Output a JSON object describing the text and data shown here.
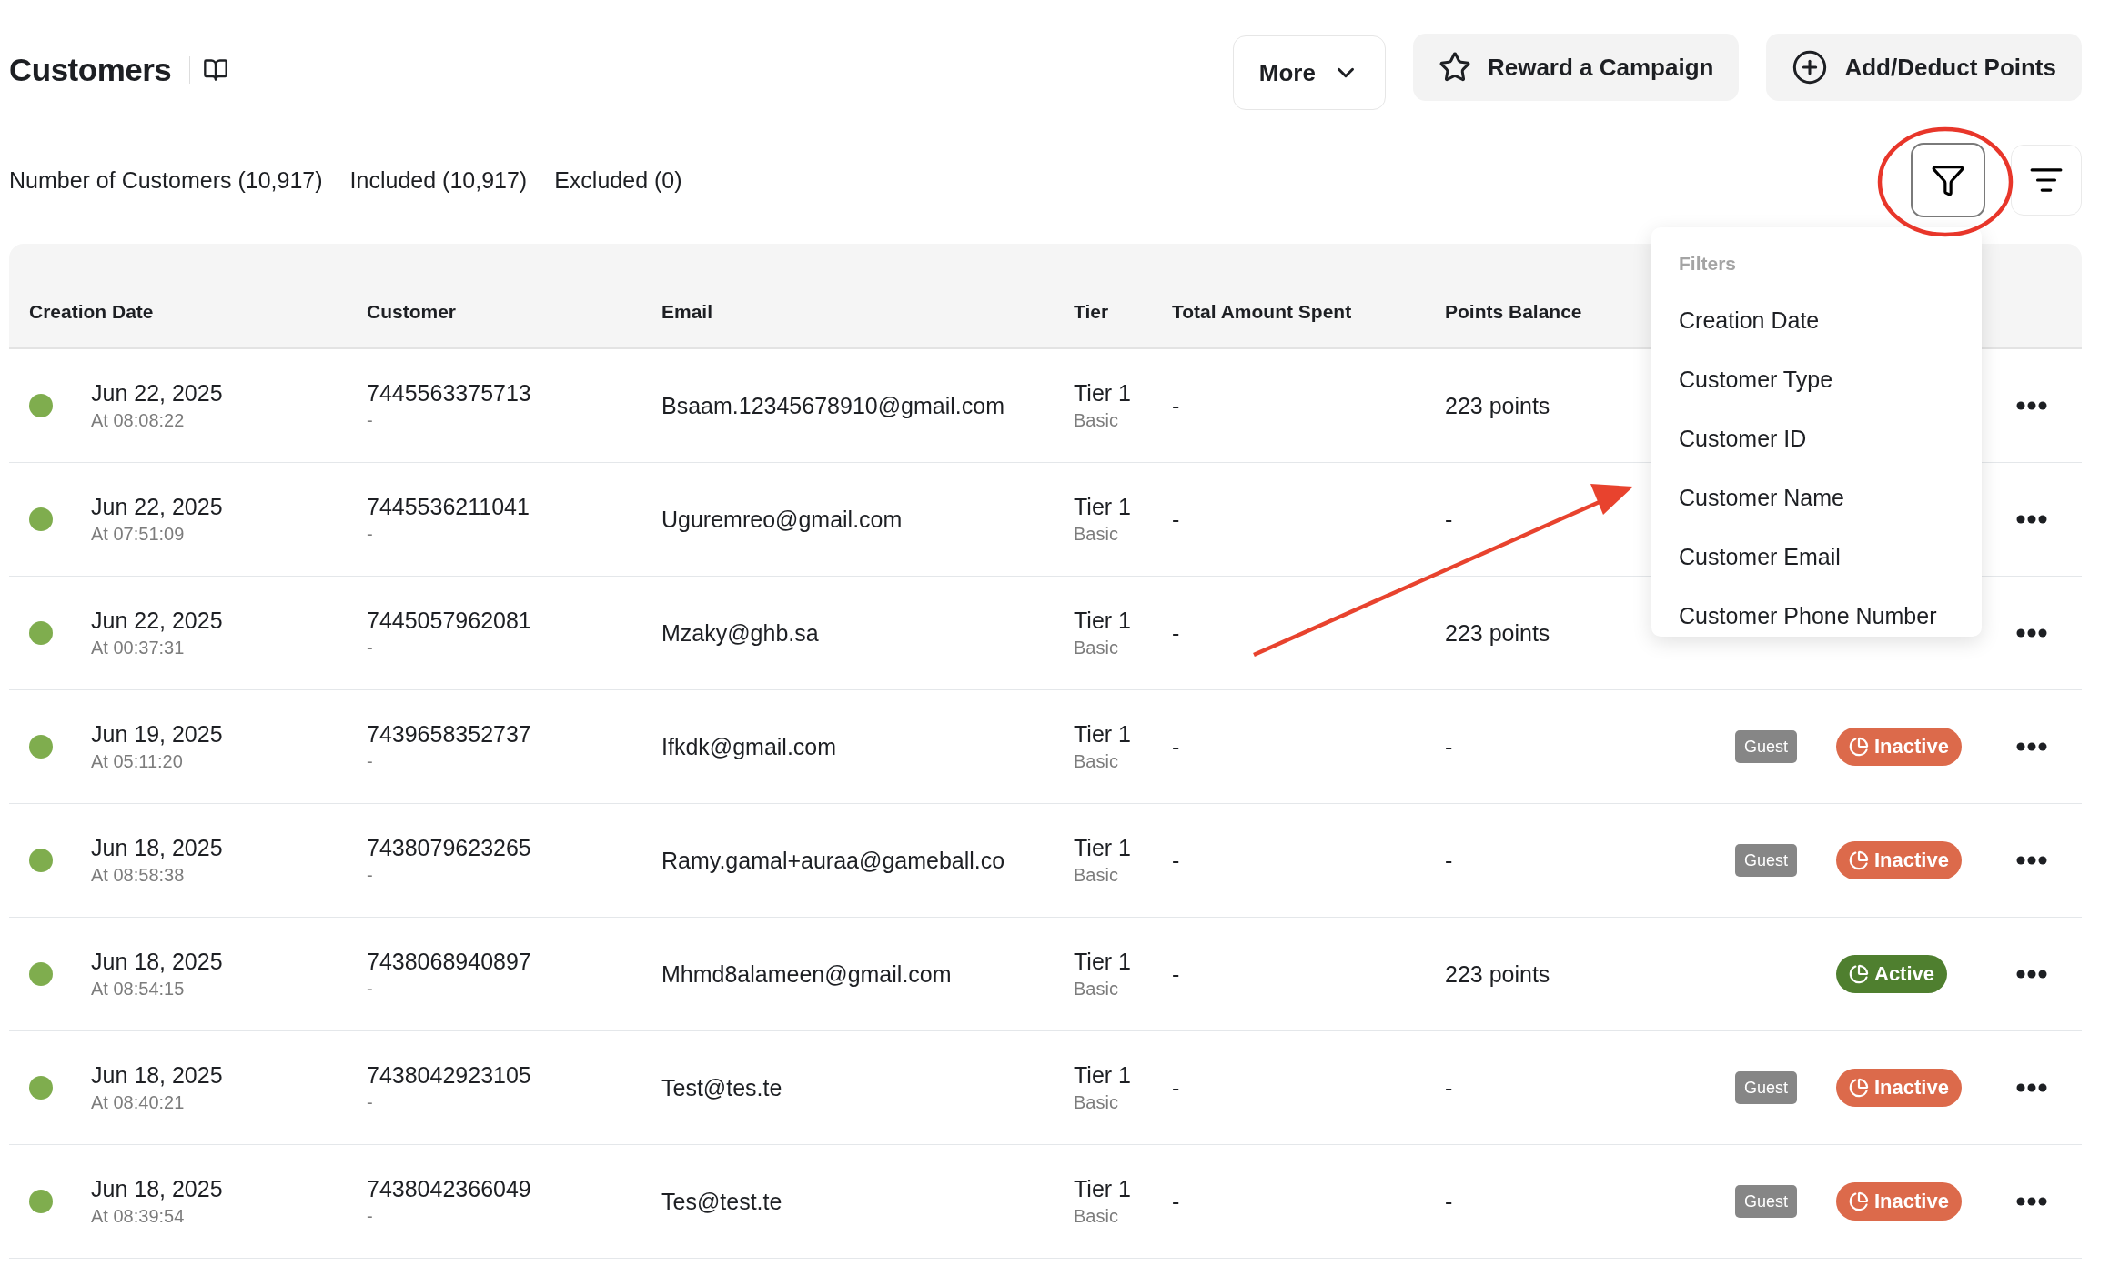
{
  "page": {
    "title": "Customers"
  },
  "toolbar": {
    "buttons": [
      {
        "label": "More",
        "kind": "dropdown"
      },
      {
        "label": "Reward a Campaign",
        "kind": "star"
      },
      {
        "label": "Add/Deduct Points",
        "kind": "plus"
      }
    ]
  },
  "counts": [
    "Number of Customers (10,917)",
    "Included (10,917)",
    "Excluded (0)"
  ],
  "filter_menu": {
    "expanded": true,
    "heading": "Filters",
    "items": [
      "Creation Date",
      "Customer Type",
      "Customer ID",
      "Customer Name",
      "Customer Email",
      "Customer Phone Number"
    ]
  },
  "table": {
    "columns": [
      "Creation Date",
      "Customer",
      "Email",
      "Tier",
      "Total Amount Spent",
      "Points Balance"
    ],
    "rows": [
      {
        "date": "Jun 22, 2025",
        "time": "At 08:08:22",
        "customer_id": "7445563375713",
        "customer_name": "-",
        "email": "Bsaam.12345678910@gmail.com",
        "tier": "Tier 1",
        "tier_name": "Basic",
        "total_spent": "-",
        "points": "223 points"
      },
      {
        "date": "Jun 22, 2025",
        "time": "At 07:51:09",
        "customer_id": "7445536211041",
        "customer_name": "-",
        "email": "Uguremreo@gmail.com",
        "tier": "Tier 1",
        "tier_name": "Basic",
        "total_spent": "-",
        "points": "-"
      },
      {
        "date": "Jun 22, 2025",
        "time": "At 00:37:31",
        "customer_id": "7445057962081",
        "customer_name": "-",
        "email": "Mzaky@ghb.sa",
        "tier": "Tier 1",
        "tier_name": "Basic",
        "total_spent": "-",
        "points": "223 points"
      },
      {
        "date": "Jun 19, 2025",
        "time": "At 05:11:20",
        "customer_id": "7439658352737",
        "customer_name": "-",
        "email": "Ifkdk@gmail.com",
        "tier": "Tier 1",
        "tier_name": "Basic",
        "total_spent": "-",
        "points": "-",
        "type": "Guest",
        "status": {
          "label": "Inactive",
          "kind": "inactive"
        }
      },
      {
        "date": "Jun 18, 2025",
        "time": "At 08:58:38",
        "customer_id": "7438079623265",
        "customer_name": "-",
        "email": "Ramy.gamal+auraa@gameball.co",
        "tier": "Tier 1",
        "tier_name": "Basic",
        "total_spent": "-",
        "points": "-",
        "type": "Guest",
        "status": {
          "label": "Inactive",
          "kind": "inactive"
        }
      },
      {
        "date": "Jun 18, 2025",
        "time": "At 08:54:15",
        "customer_id": "7438068940897",
        "customer_name": "-",
        "email": "Mhmd8alameen@gmail.com",
        "tier": "Tier 1",
        "tier_name": "Basic",
        "total_spent": "-",
        "points": "223 points",
        "status": {
          "label": "Active",
          "kind": "active"
        }
      },
      {
        "date": "Jun 18, 2025",
        "time": "At 08:40:21",
        "customer_id": "7438042923105",
        "customer_name": "-",
        "email": "Test@tes.te",
        "tier": "Tier 1",
        "tier_name": "Basic",
        "total_spent": "-",
        "points": "-",
        "type": "Guest",
        "status": {
          "label": "Inactive",
          "kind": "inactive"
        }
      },
      {
        "date": "Jun 18, 2025",
        "time": "At 08:39:54",
        "customer_id": "7438042366049",
        "customer_name": "-",
        "email": "Tes@test.te",
        "tier": "Tier 1",
        "tier_name": "Basic",
        "total_spent": "-",
        "points": "-",
        "type": "Guest",
        "status": {
          "label": "Inactive",
          "kind": "inactive"
        }
      }
    ]
  }
}
